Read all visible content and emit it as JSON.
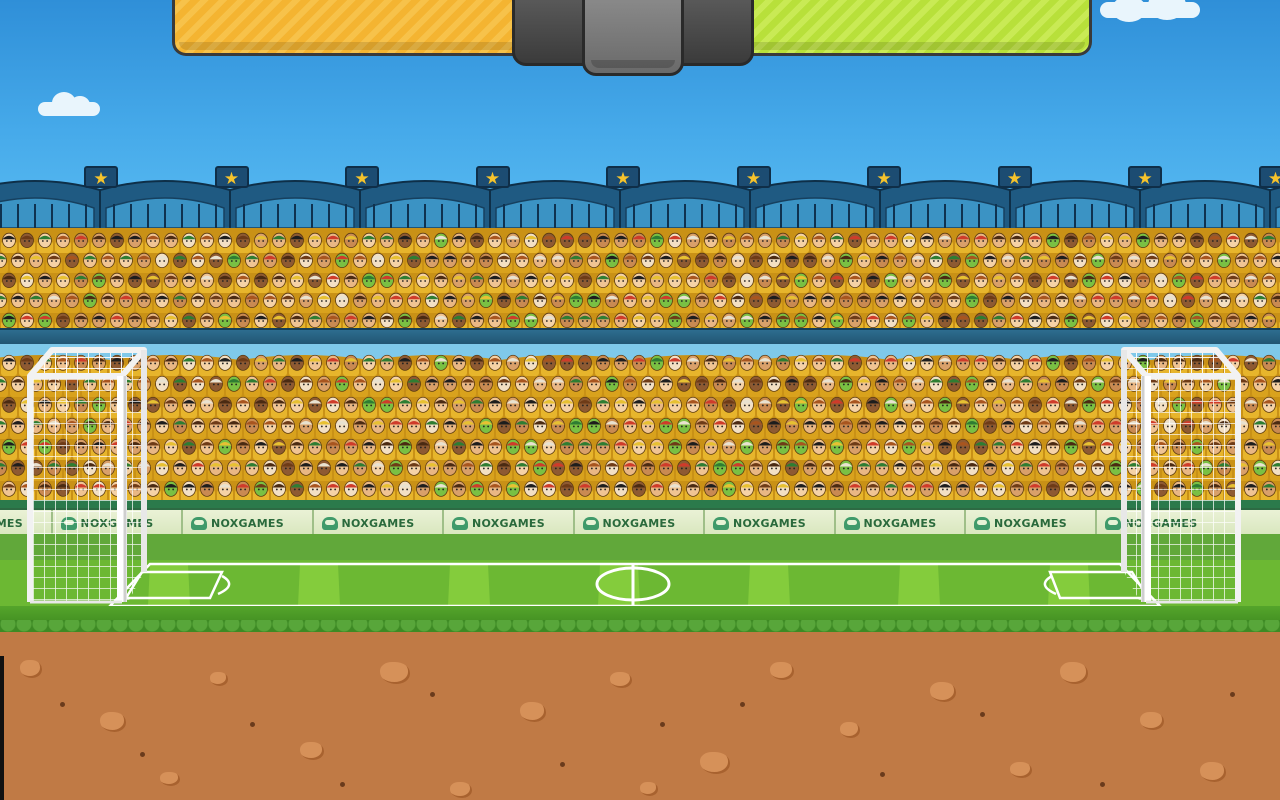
{
  "game": {
    "title": "",
    "sponsor_text": "NOXGAMES"
  },
  "hud": {
    "left_bar": {
      "color": "#f4b431",
      "fill": 1.0
    },
    "right_bar": {
      "color": "#b8e03a",
      "fill": 1.0
    },
    "center_hub": {
      "color": "#6a6a6a"
    }
  },
  "stadium": {
    "roof_star_icon": "star-icon",
    "roof_star_glyph": "★",
    "ad_boards": [
      "NOXGAMES",
      "NOXGAMES",
      "NOXGAMES",
      "NOXGAMES",
      "NOXGAMES",
      "NOXGAMES",
      "NOXGAMES",
      "NOXGAMES",
      "NOXGAMES",
      "NOXGAMES"
    ]
  },
  "colors": {
    "sky": "#46aaea",
    "grass": "#7bc43a",
    "dirt": "#c07a45",
    "crowd": "#e7b52c"
  }
}
